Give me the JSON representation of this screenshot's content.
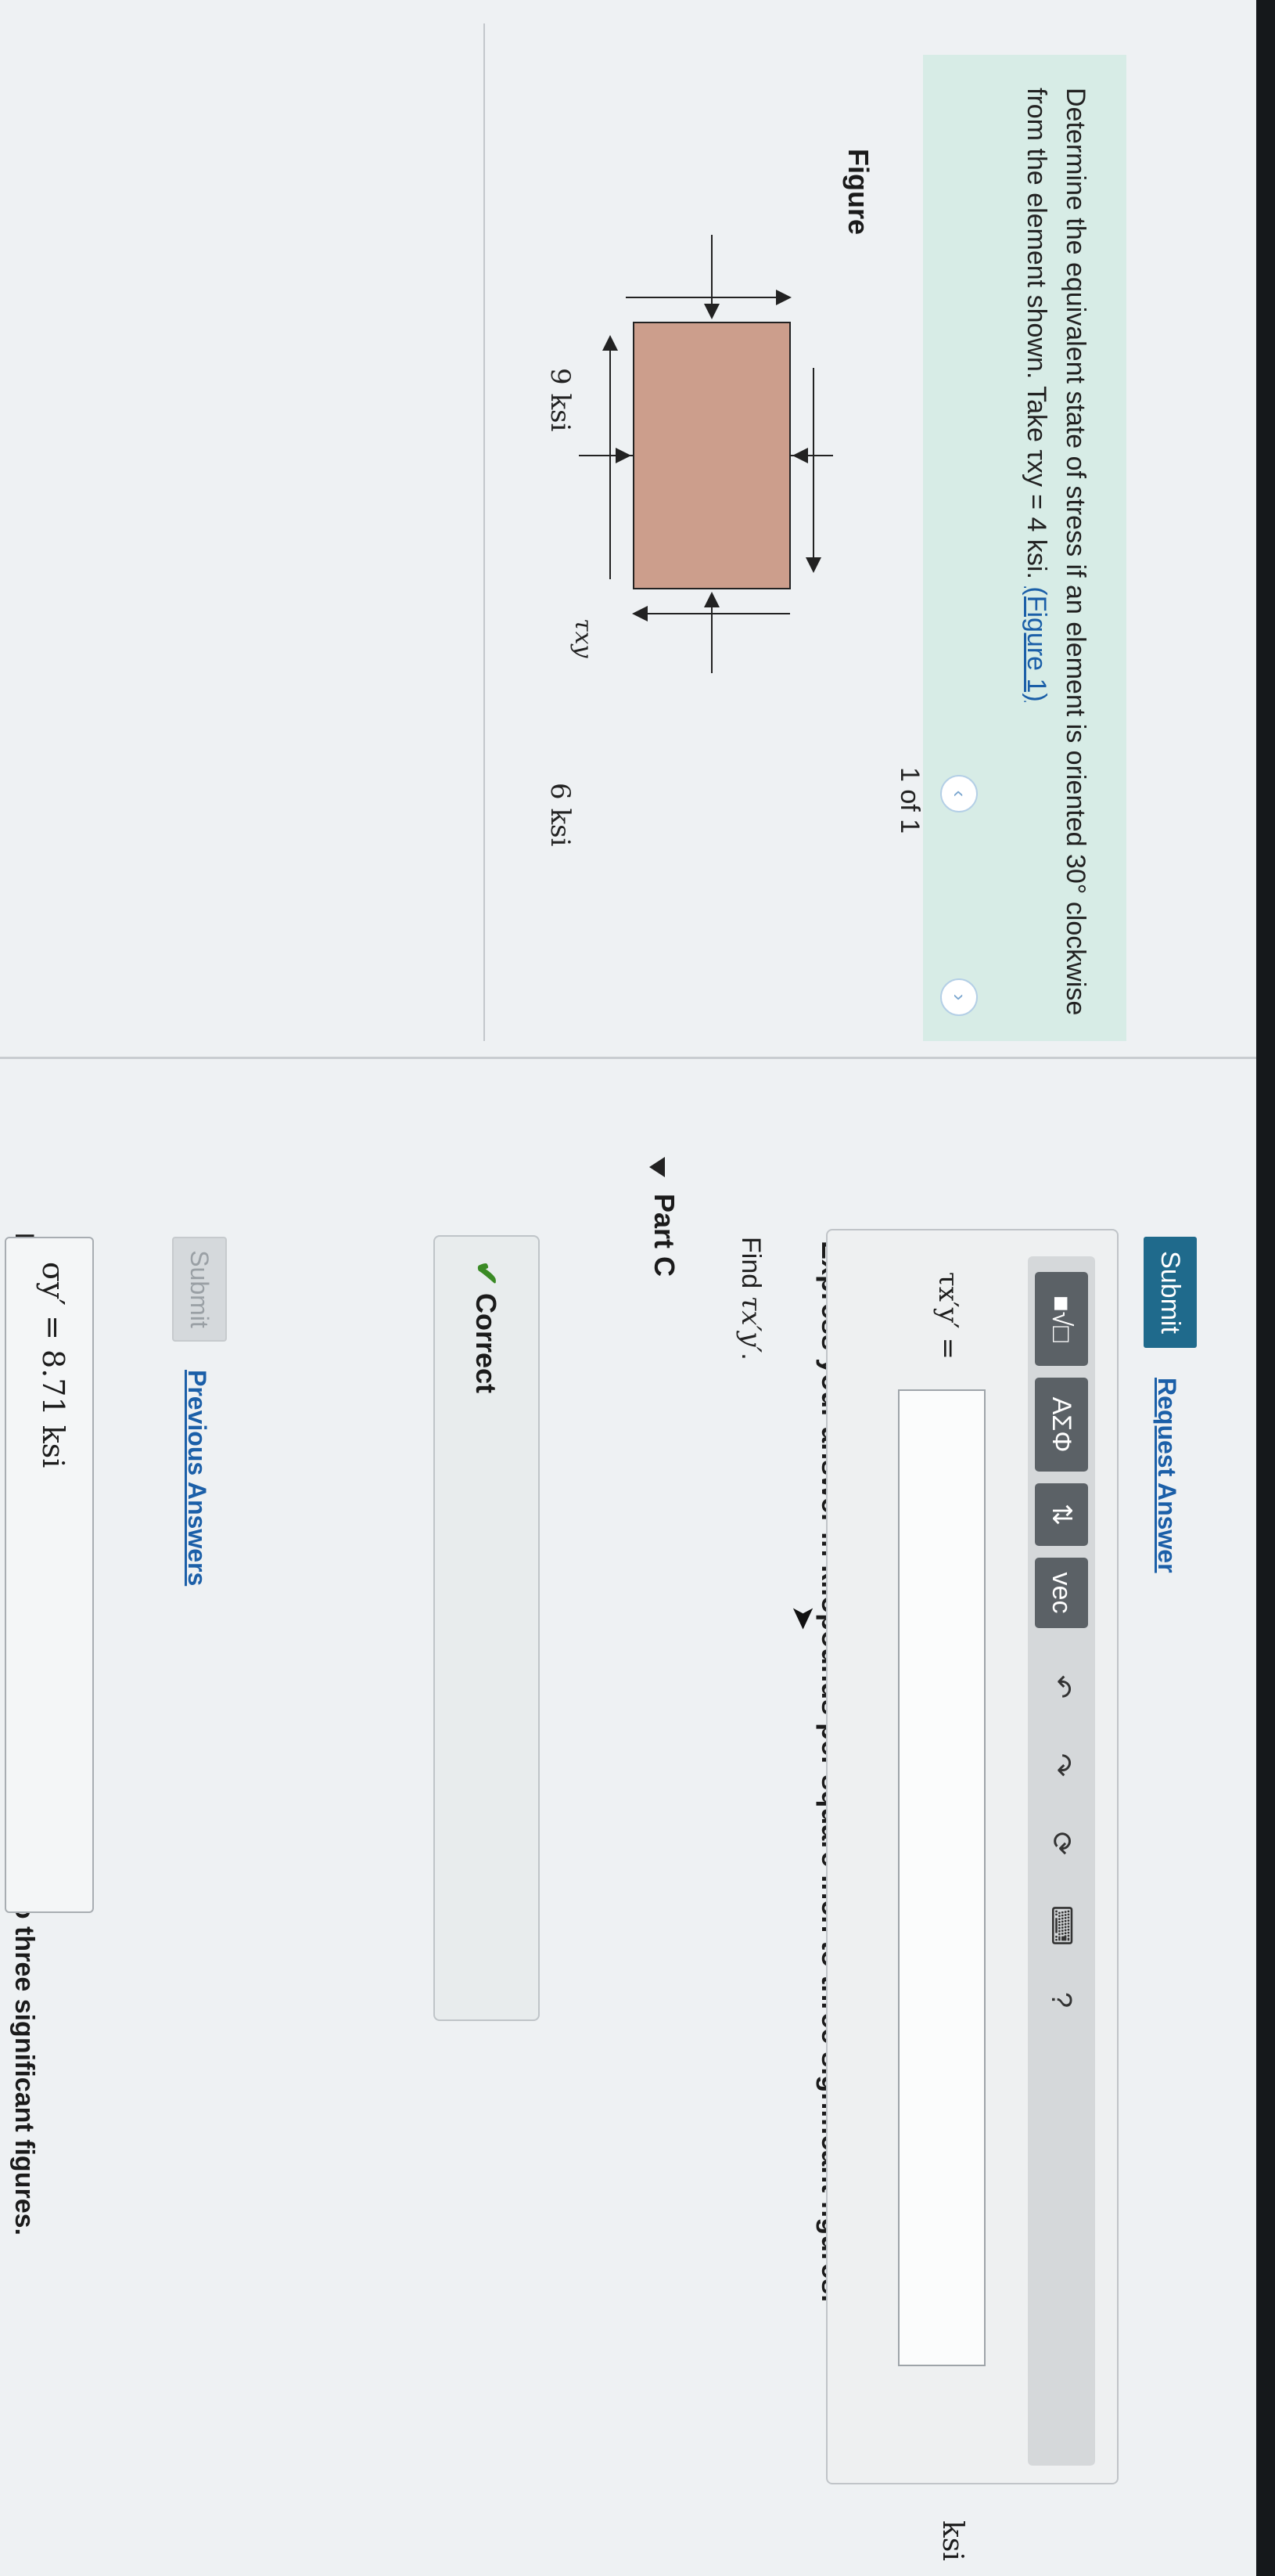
{
  "problem": {
    "text": "Determine the equivalent state of stress if an element is oriented 30° clockwise from the element shown. Take τxy = 4 ksi.",
    "figure_link": "(Figure 1)"
  },
  "figure": {
    "heading": "Figure",
    "label_top_stress": "9 ksi",
    "label_side_stress": "6 ksi",
    "label_shear": "τxy",
    "pager_text": "1 of 1"
  },
  "part_b": {
    "instruction": "Express your answer in kilopounds per square inch to three significant figures.",
    "answer_text": "σy′ = 8.71  ksi",
    "submit_label": "Submit",
    "previous_answers_label": "Previous Answers",
    "status_label": "Correct"
  },
  "part_c": {
    "title": "Part C",
    "find_prefix": "Find",
    "find_symbol": "τx′y′",
    "instruction": "Express your answer in kilopounds per square inch to three significant figures.",
    "toolbar": {
      "templates": "■√□",
      "greek": "ΑΣΦ",
      "arrows": "⇅",
      "vec": "vec",
      "help": "?"
    },
    "variable_label": "τx′y′ =",
    "input_value": "",
    "unit": "ksi",
    "submit_label": "Submit",
    "request_answer_label": "Request Answer"
  },
  "colors": {
    "element_fill": "#cc9e8c",
    "accent_link": "#1b5fa8",
    "submit_bg": "#1f6a8c",
    "correct_check": "#3a8a25"
  },
  "icons": [
    "undo-icon",
    "redo-icon",
    "reset-icon",
    "keyboard-icon",
    "pointer-cursor-icon",
    "chevron-left-icon",
    "chevron-right-icon",
    "check-icon",
    "triangle-down-icon"
  ]
}
